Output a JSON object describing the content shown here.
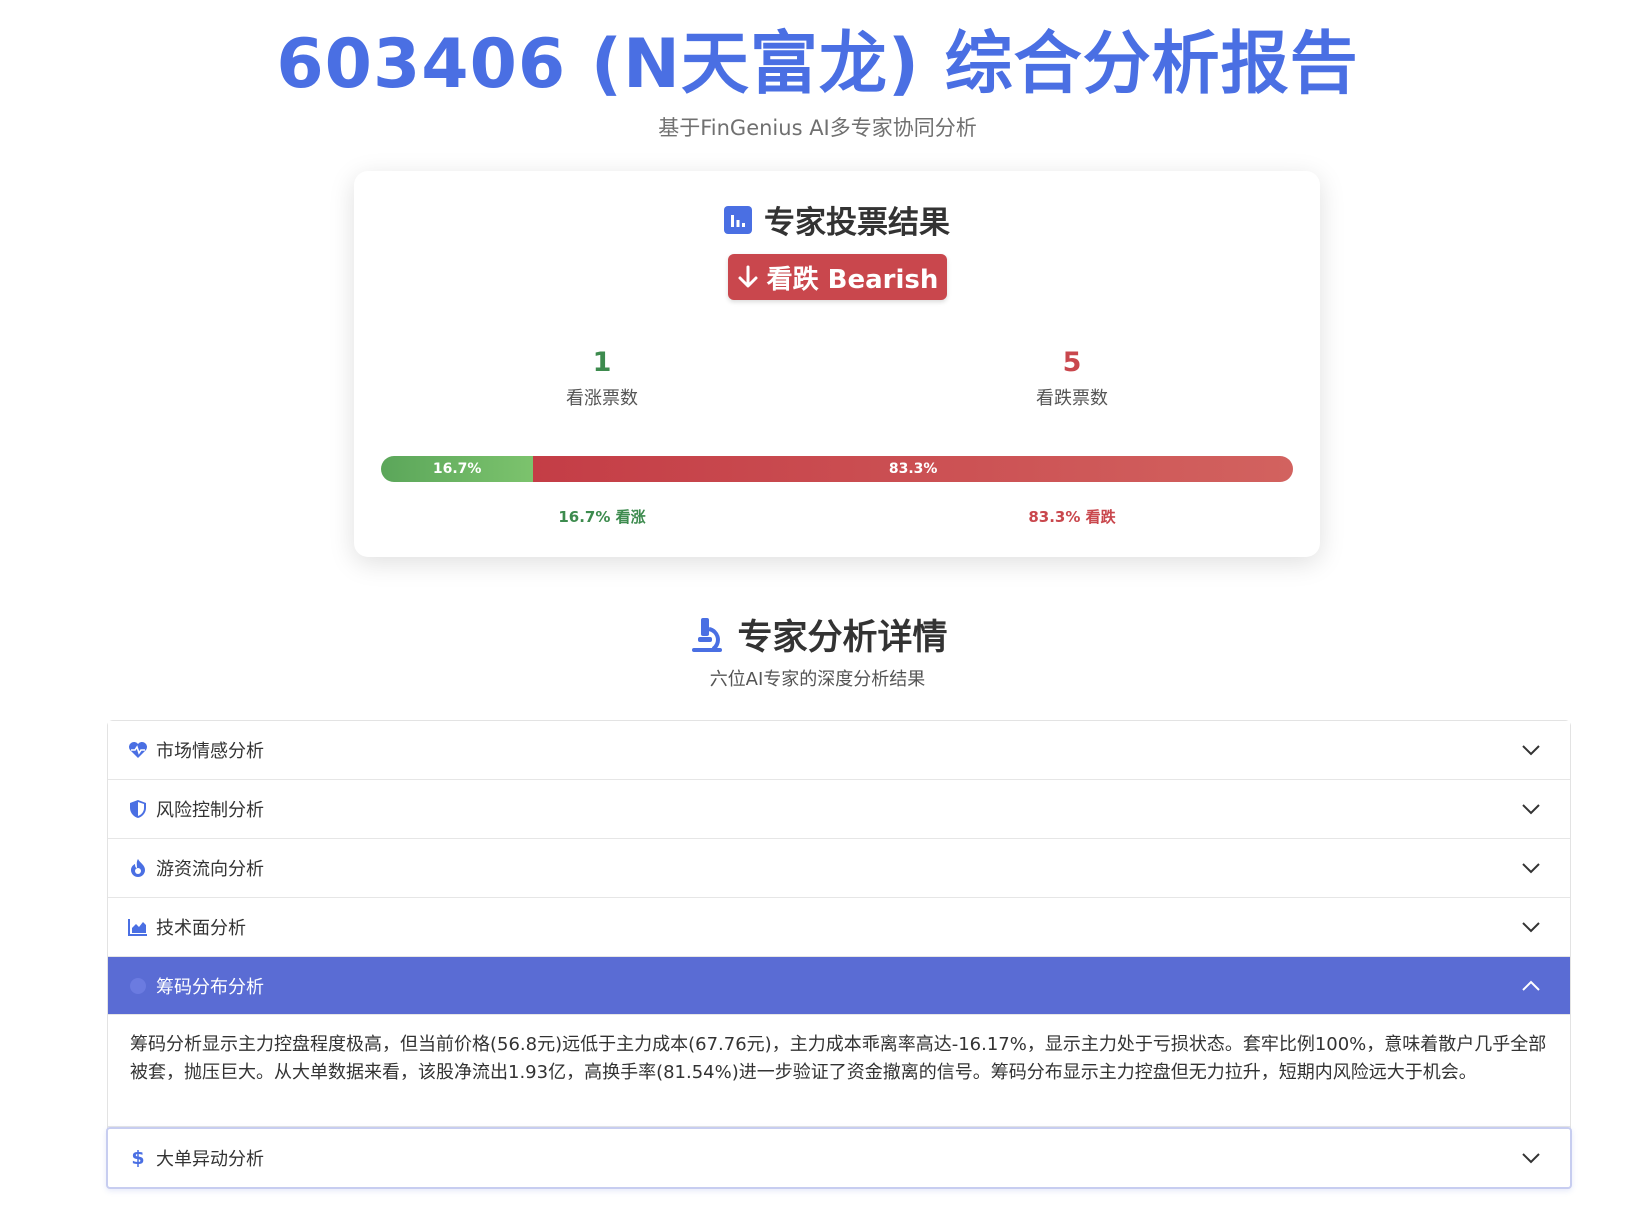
{
  "header": {
    "title": "603406 (N天富龙) 综合分析报告",
    "subtitle": "基于FinGenius AI多专家协同分析"
  },
  "vote": {
    "title": "专家投票结果",
    "verdict": "看跌 Bearish",
    "bull_count": "1",
    "bull_label": "看涨票数",
    "bear_count": "5",
    "bear_label": "看跌票数",
    "bull_pct": "16.7%",
    "bear_pct": "83.3%",
    "bull_fraction": 0.167,
    "bull_legend": "16.7% 看涨",
    "bear_legend": "83.3% 看跌",
    "colors": {
      "bull": "#5ba65a",
      "bear": "#c9474d",
      "accent": "#4a6fe3"
    }
  },
  "details": {
    "title": "专家分析详情",
    "subtitle": "六位AI专家的深度分析结果"
  },
  "accordion": {
    "items": [
      {
        "label": "市场情感分析",
        "icon": "heart-pulse-icon"
      },
      {
        "label": "风险控制分析",
        "icon": "shield-icon"
      },
      {
        "label": "游资流向分析",
        "icon": "fire-icon"
      },
      {
        "label": "技术面分析",
        "icon": "area-chart-icon"
      },
      {
        "label": "筹码分布分析",
        "icon": "chip-icon"
      },
      {
        "label": "大单异动分析",
        "icon": "dollar-icon"
      }
    ],
    "active_body": "筹码分析显示主力控盘程度极高，但当前价格(56.8元)远低于主力成本(67.76元)，主力成本乖离率高达-16.17%，显示主力处于亏损状态。套牢比例100%，意味着散户几乎全部被套，抛压巨大。从大单数据来看，该股净流出1.93亿，高换手率(81.54%)进一步验证了资金撤离的信号。筹码分布显示主力控盘但无力拉升，短期内风险远大于机会。"
  }
}
